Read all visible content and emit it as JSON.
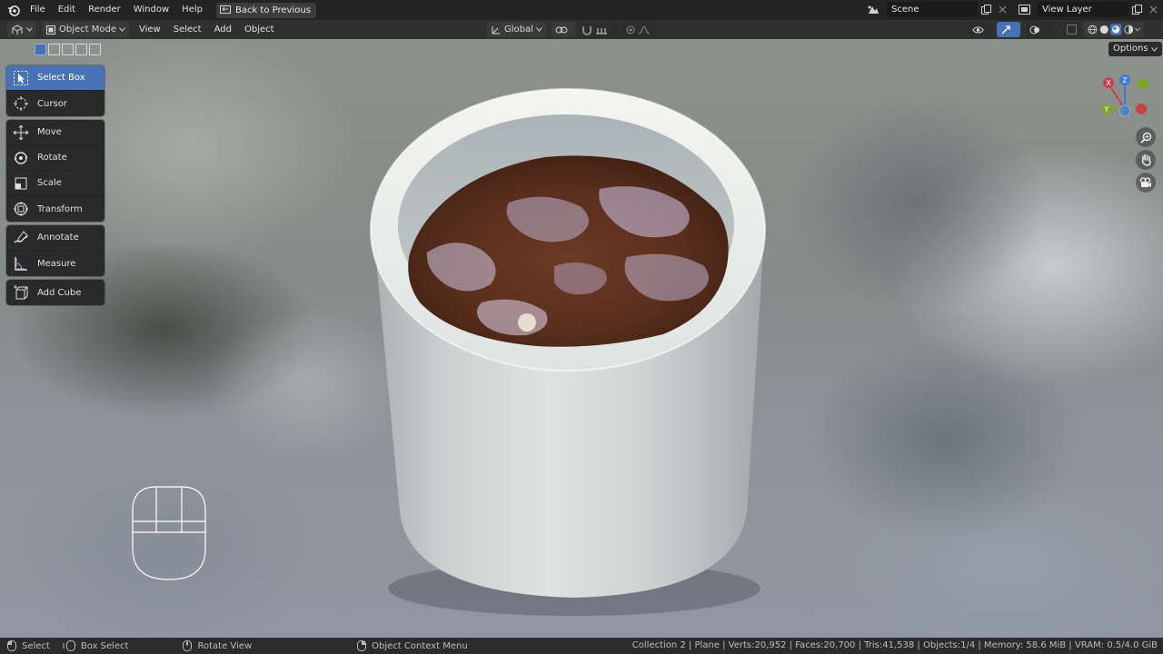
{
  "topbar": {
    "menus": [
      "File",
      "Edit",
      "Render",
      "Window",
      "Help"
    ],
    "back_label": "Back to Previous",
    "scene": "Scene",
    "view_layer": "View Layer"
  },
  "header": {
    "mode": "Object Mode",
    "menus": [
      "View",
      "Select",
      "Add",
      "Object"
    ],
    "orientation": "Global"
  },
  "toolbar": {
    "groups": [
      [
        "Select Box",
        "Cursor"
      ],
      [
        "Move",
        "Rotate",
        "Scale",
        "Transform"
      ],
      [
        "Annotate",
        "Measure"
      ],
      [
        "Add Cube"
      ]
    ],
    "active": "Select Box"
  },
  "gizmo": {
    "x": "X",
    "y": "Y",
    "z": "Z"
  },
  "options_label": "Options",
  "statusbar": {
    "select": "Select",
    "box_select": "Box Select",
    "rotate_view": "Rotate View",
    "context_menu": "Object Context Menu",
    "stats": "Collection 2 | Plane | Verts:20,952 | Faces:20,700 | Tris:41,538 | Objects:1/4 | Memory: 58.6 MiB | VRAM: 0.5/4.0 GiB"
  },
  "colors": {
    "accent": "#4772b3",
    "x_axis": "#c8424c",
    "y_axis": "#7fa32b",
    "z_axis": "#3b7bd1"
  }
}
